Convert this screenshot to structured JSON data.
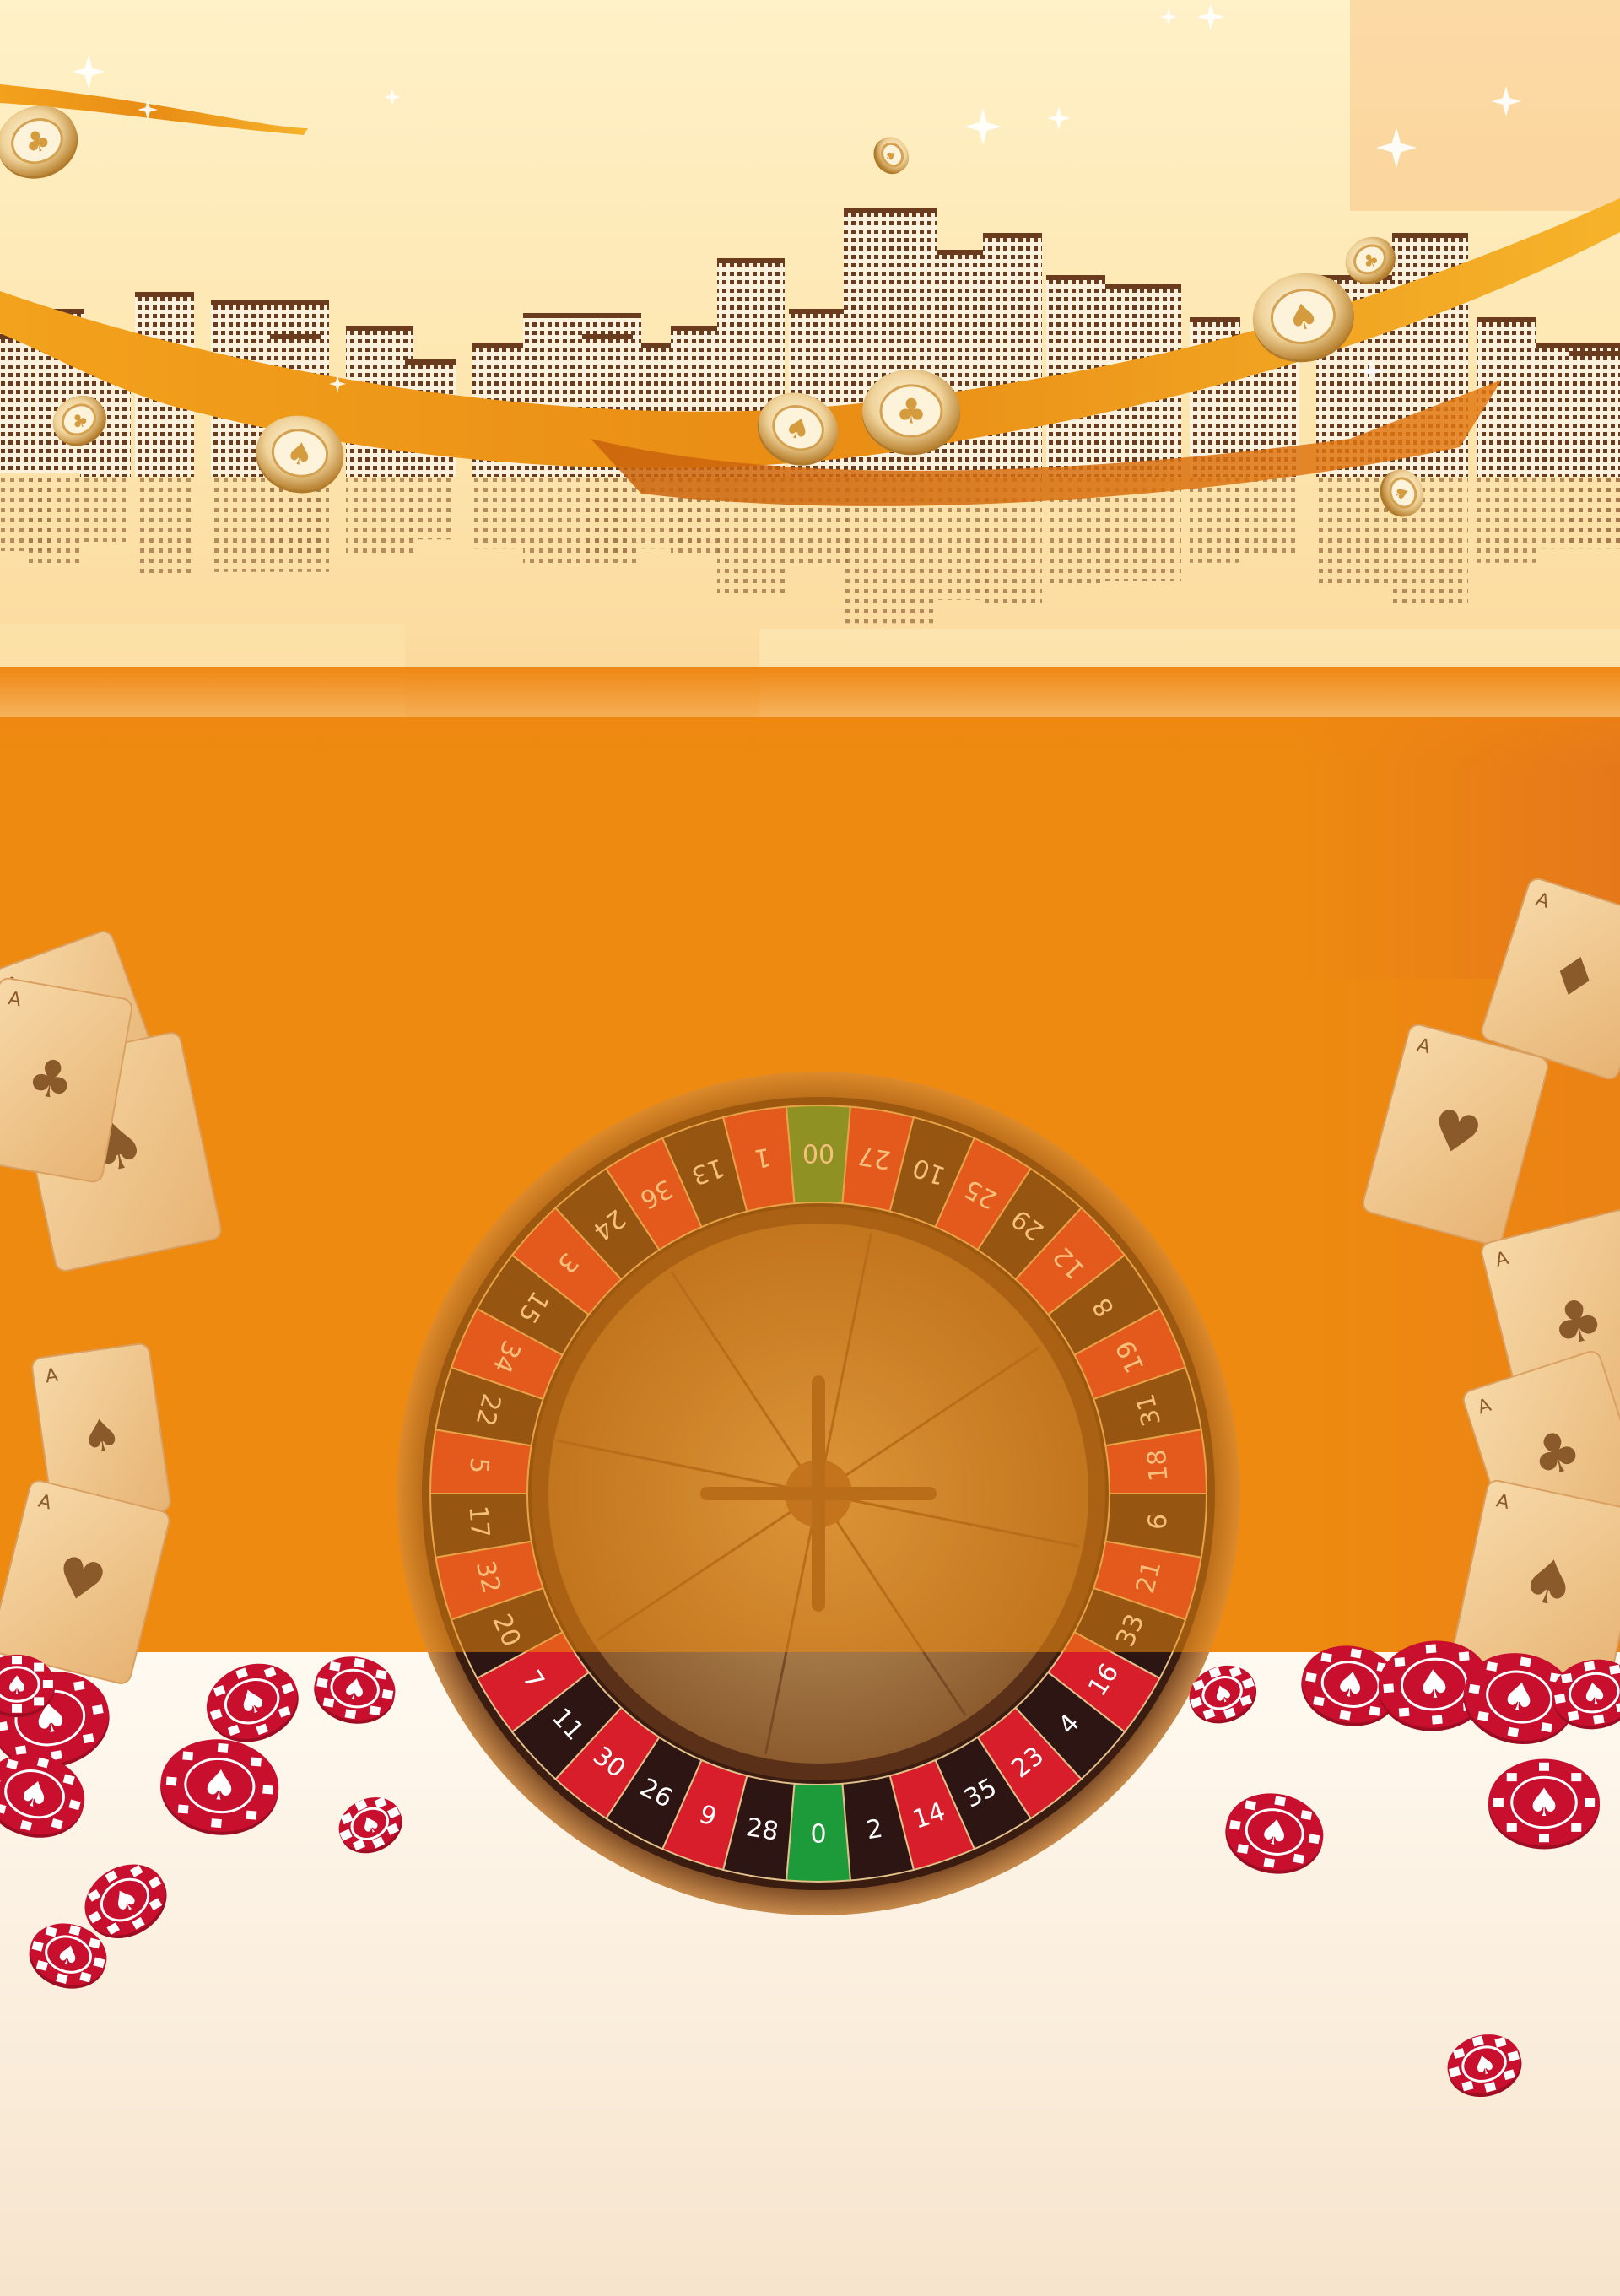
{
  "colors": {
    "sky_top": "#fff2c4",
    "sky_bottom": "#fde7b0",
    "banner": "#ee8a10",
    "banner_light": "#f29a1c",
    "cream": "#fbf3e6",
    "chip_red": "#c8102e",
    "chip_gold": "#e9c27b",
    "roulette_red": "#d81e2b",
    "roulette_black": "#2c1512",
    "roulette_green": "#1d9a3a",
    "wood": "#7a4a25"
  },
  "icons": {
    "sparkle": "sparkle-icon",
    "spade": "spade-icon",
    "club": "club-icon",
    "heart": "heart-icon",
    "diamond": "diamond-icon"
  },
  "roulette": {
    "numbers": [
      "0",
      "28",
      "9",
      "26",
      "30",
      "11",
      "7",
      "20",
      "32",
      "17",
      "5",
      "22",
      "34",
      "15",
      "3",
      "24",
      "36",
      "13",
      "1",
      "00",
      "27",
      "10",
      "25",
      "29",
      "12",
      "8",
      "19",
      "31",
      "18",
      "6",
      "21",
      "33",
      "16",
      "4",
      "23",
      "35",
      "14",
      "2"
    ],
    "colors": [
      "g",
      "b",
      "r",
      "b",
      "r",
      "b",
      "r",
      "b",
      "r",
      "b",
      "r",
      "b",
      "r",
      "b",
      "r",
      "b",
      "r",
      "b",
      "r",
      "g",
      "r",
      "b",
      "r",
      "b",
      "r",
      "b",
      "r",
      "b",
      "r",
      "b",
      "r",
      "b",
      "r",
      "b",
      "r",
      "b",
      "r",
      "b"
    ]
  },
  "cards": [
    {
      "rank": "A",
      "suit": "spade"
    },
    {
      "rank": "A",
      "suit": "spade"
    },
    {
      "rank": "A",
      "suit": "club"
    },
    {
      "rank": "A",
      "suit": "heart"
    },
    {
      "rank": "A",
      "suit": "diamond"
    },
    {
      "rank": "A",
      "suit": "club"
    },
    {
      "rank": "A",
      "suit": "spade"
    },
    {
      "rank": "A",
      "suit": "heart"
    },
    {
      "rank": "A",
      "suit": "club"
    },
    {
      "rank": "A",
      "suit": "spade"
    }
  ]
}
